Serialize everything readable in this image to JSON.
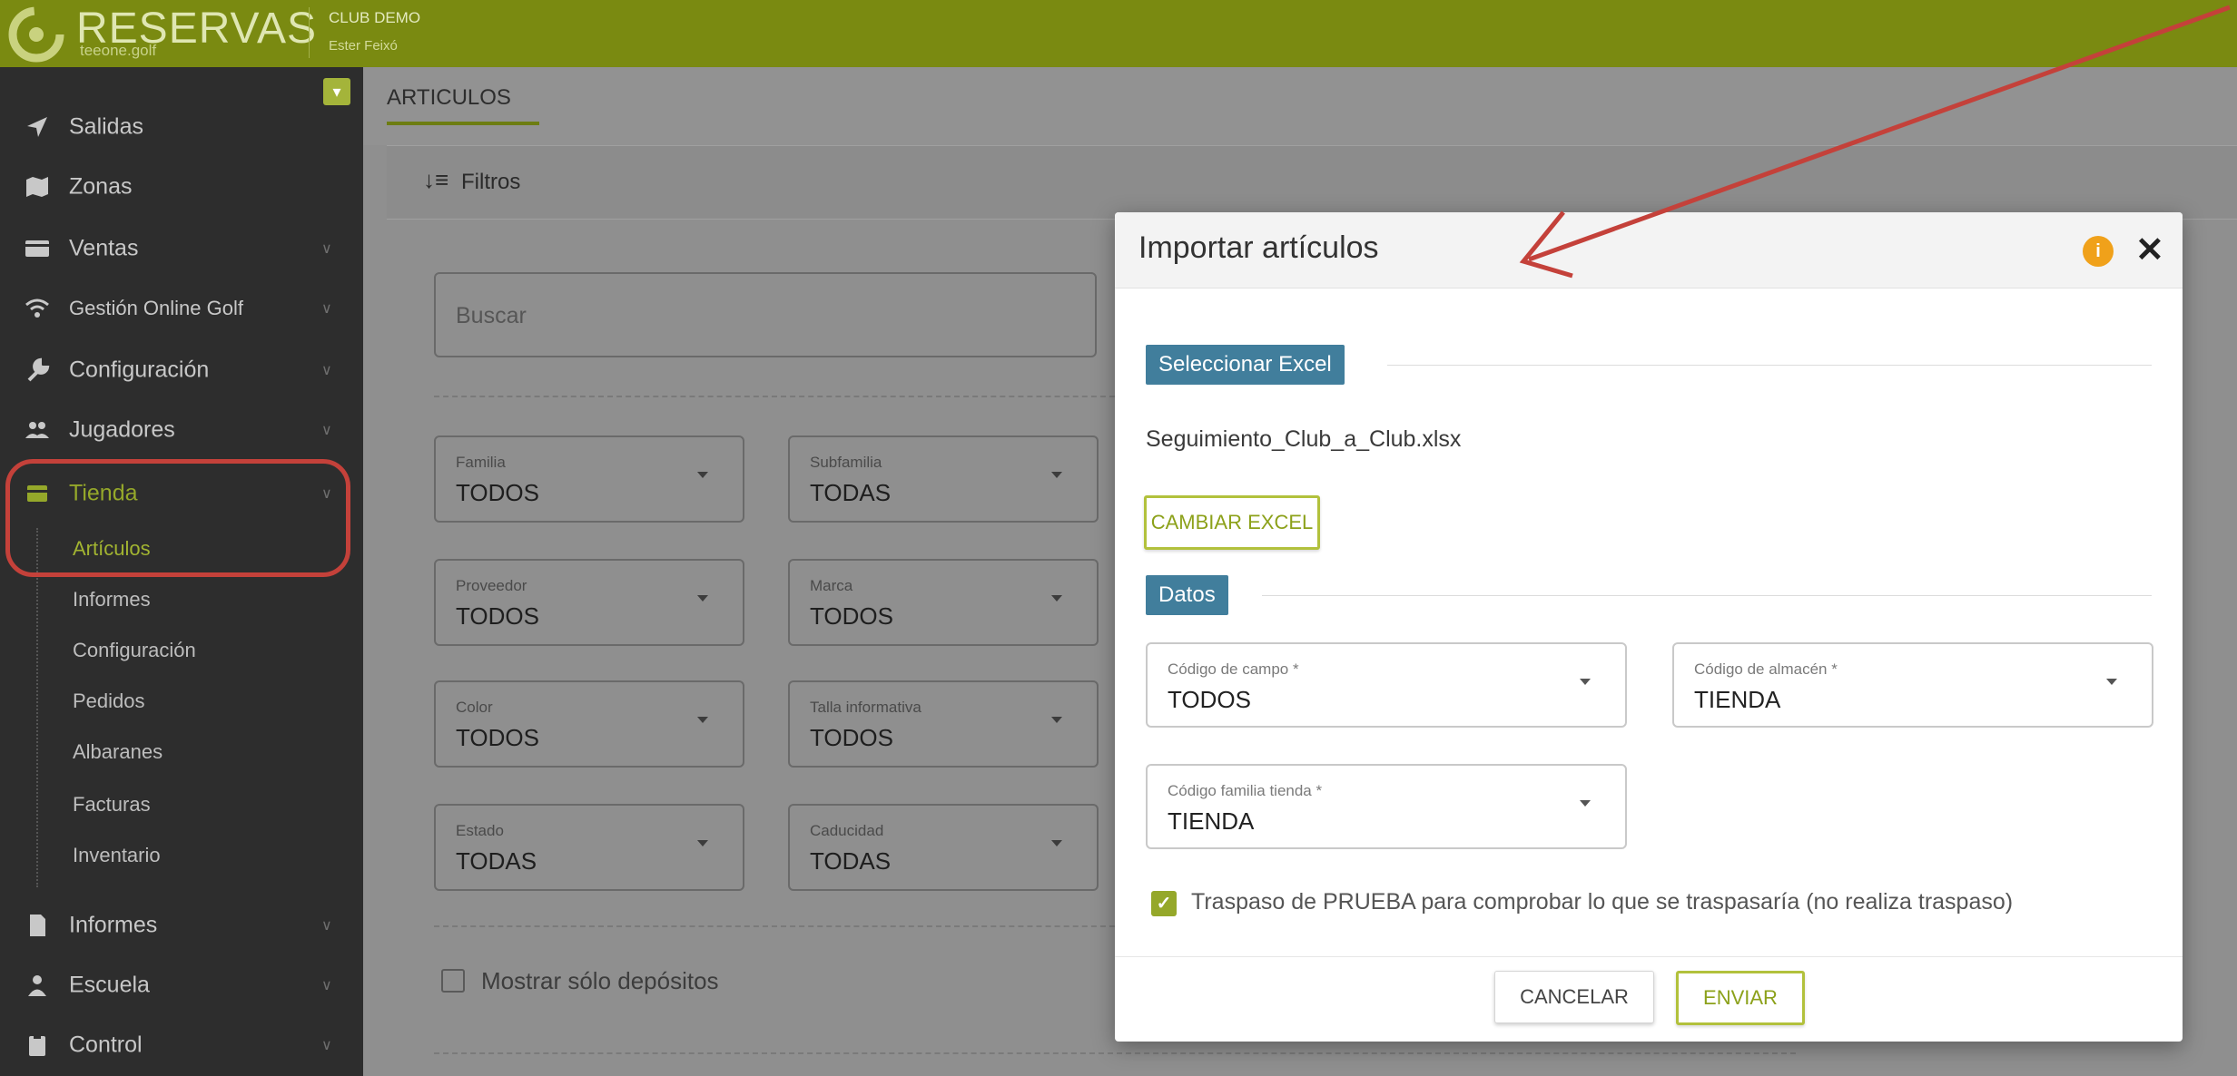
{
  "header": {
    "brand": "RESERVAS",
    "brand_sub": "teeone.golf",
    "club": "CLUB DEMO",
    "user": "Ester Feixó"
  },
  "sidebar": {
    "items": [
      {
        "label": "Salidas",
        "icon": "paper-plane-icon"
      },
      {
        "label": "Zonas",
        "icon": "map-icon"
      },
      {
        "label": "Ventas",
        "icon": "credit-card-icon"
      },
      {
        "label": "Gestión Online Golf",
        "icon": "wifi-icon"
      },
      {
        "label": "Configuración",
        "icon": "wrench-icon"
      },
      {
        "label": "Jugadores",
        "icon": "users-icon"
      },
      {
        "label": "Tienda",
        "icon": "store-icon"
      },
      {
        "label": "Informes",
        "icon": "file-icon"
      },
      {
        "label": "Escuela",
        "icon": "school-icon"
      },
      {
        "label": "Control",
        "icon": "clipboard-icon"
      }
    ],
    "tienda_subitems": [
      "Artículos",
      "Informes",
      "Configuración",
      "Pedidos",
      "Albaranes",
      "Facturas",
      "Inventario"
    ],
    "active_item": "Tienda",
    "active_subitem": "Artículos"
  },
  "main": {
    "tab": "ARTICULOS",
    "filters_label": "Filtros",
    "search_placeholder": "Buscar",
    "selects": [
      {
        "label": "Familia",
        "value": "TODOS"
      },
      {
        "label": "Subfamilia",
        "value": "TODAS"
      },
      {
        "label": "Proveedor",
        "value": "TODOS"
      },
      {
        "label": "Marca",
        "value": "TODOS"
      },
      {
        "label": "Color",
        "value": "TODOS"
      },
      {
        "label": "Talla informativa",
        "value": "TODOS"
      },
      {
        "label": "Estado",
        "value": "TODAS"
      },
      {
        "label": "Caducidad",
        "value": "TODAS"
      }
    ],
    "deposit_checkbox_label": "Mostrar sólo depósitos"
  },
  "modal": {
    "title": "Importar artículos",
    "section_excel": "Seleccionar Excel",
    "filename": "Seguimiento_Club_a_Club.xlsx",
    "change_excel": "CAMBIAR EXCEL",
    "section_data": "Datos",
    "fields": [
      {
        "label": "Código de campo *",
        "value": "TODOS"
      },
      {
        "label": "Código de almacén *",
        "value": "TIENDA"
      },
      {
        "label": "Código familia tienda *",
        "value": "TIENDA"
      }
    ],
    "test_checkbox_label": "Traspaso de PRUEBA para comprobar lo que se traspasaría (no realiza traspaso)",
    "test_checked": true,
    "cancel": "CANCELAR",
    "send": "ENVIAR"
  },
  "colors": {
    "topbar": "#7a8a11",
    "accent": "#95a82a",
    "section_tag": "#417e9c",
    "annotation_red": "#c4413a",
    "info_orange": "#f0a11a"
  }
}
